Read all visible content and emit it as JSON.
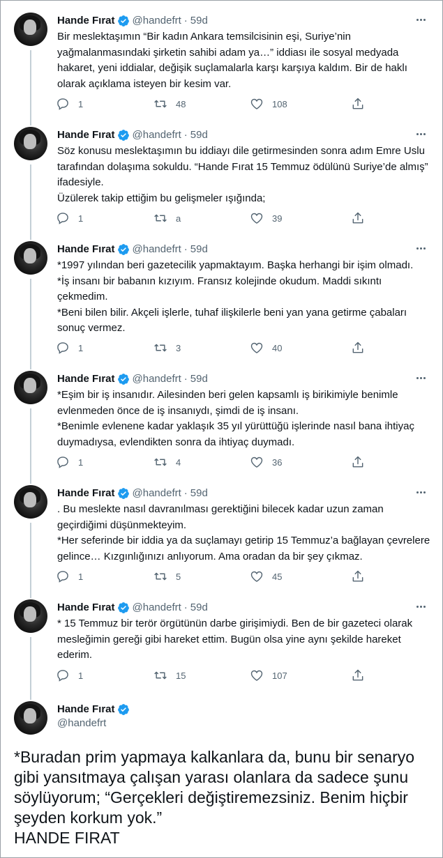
{
  "author": {
    "name": "Hande Fırat",
    "handle": "@handefrt",
    "time": "59d"
  },
  "tweets": [
    {
      "lines": [
        "Bir meslektaşımın “Bir kadın Ankara temsilcisinin eşi, Suriye’nin yağmalanmasındaki şirketin sahibi adam ya…” iddiası ile sosyal medyada hakaret, yeni iddialar, değişik suçlamalarla karşı karşıya kaldım. Bir de haklı olarak açıklama isteyen bir kesim var."
      ],
      "replies": "1",
      "retweets": "48",
      "likes": "108"
    },
    {
      "lines": [
        "Söz konusu meslektaşımın bu iddiayı dile getirmesinden sonra adım Emre Uslu tarafından dolaşıma sokuldu. “Hande Fırat 15 Temmuz ödülünü Suriye’de almış” ifadesiyle.",
        "Üzülerek takip ettiğim bu gelişmeler ışığında;"
      ],
      "replies": "1",
      "retweets": "a",
      "likes": "39"
    },
    {
      "lines": [
        "*1997 yılından beri gazetecilik yapmaktayım. Başka herhangi bir işim olmadı.",
        "*İş insanı bir babanın kızıyım. Fransız kolejinde okudum. Maddi sıkıntı çekmedim.",
        "*Beni bilen bilir. Akçeli işlerle, tuhaf ilişkilerle beni yan yana getirme çabaları sonuç vermez."
      ],
      "replies": "1",
      "retweets": "3",
      "likes": "40"
    },
    {
      "lines": [
        "*Eşim bir iş insanıdır. Ailesinden beri gelen kapsamlı iş birikimiyle benimle evlenmeden önce de iş insanıydı, şimdi de iş insanı.",
        "*Benimle evlenene kadar yaklaşık 35 yıl yürüttüğü işlerinde nasıl bana ihtiyaç duymadıysa, evlendikten sonra da ihtiyaç duymadı."
      ],
      "replies": "1",
      "retweets": "4",
      "likes": "36"
    },
    {
      "lines": [
        ". Bu meslekte nasıl davranılması gerektiğini bilecek kadar uzun zaman geçirdiğimi düşünmekteyim.",
        "*Her seferinde bir iddia ya da suçlamayı getirip 15 Temmuz’a bağlayan çevrelere gelince… Kızgınlığınızı anlıyorum. Ama oradan da bir şey çıkmaz."
      ],
      "replies": "1",
      "retweets": "5",
      "likes": "45"
    },
    {
      "lines": [
        "* 15 Temmuz bir terör örgütünün darbe girişimiydi. Ben de bir gazeteci olarak mesleğimin gereği gibi hareket ettim. Bugün olsa yine aynı şekilde hareket ederim."
      ],
      "replies": "1",
      "retweets": "15",
      "likes": "107"
    }
  ],
  "final_tweet": {
    "lines": [
      "*Buradan prim yapmaya kalkanlara da, bunu bir senaryo gibi yansıtmaya çalışan yarası olanlara da sadece şunu söylüyorum; “Gerçekleri değiştiremezsiniz. Benim hiçbir şeyden korkum yok.”",
      "HANDE FIRAT"
    ]
  },
  "colors": {
    "verified": "#1d9bf0",
    "secondary_text": "#536471",
    "thread_line": "#c4cfd6"
  }
}
